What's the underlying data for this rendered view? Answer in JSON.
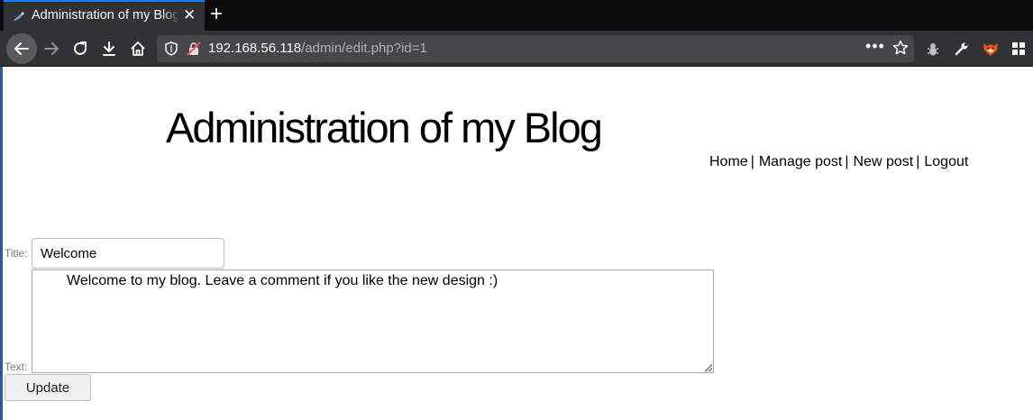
{
  "browser": {
    "tab": {
      "title": "Administration of my Blog",
      "favicon": "blog-favicon-icon"
    },
    "new_tab_label": "+",
    "url": {
      "host": "192.168.56.118",
      "path": "/admin/edit.php?id=1"
    },
    "accent": "#0a84ff"
  },
  "page": {
    "site_title": "Administration of my Blog",
    "nav": [
      {
        "label": "Home",
        "sep": "|"
      },
      {
        "label": "Manage post",
        "sep": "|"
      },
      {
        "label": "New post",
        "sep": "|"
      },
      {
        "label": "Logout",
        "sep": ""
      }
    ],
    "form": {
      "title_label": "Title:",
      "title_value": "Welcome",
      "text_label": "Text:",
      "text_value": "Welcome to my blog. Leave a comment if you like the new design :)",
      "submit_label": "Update"
    }
  }
}
